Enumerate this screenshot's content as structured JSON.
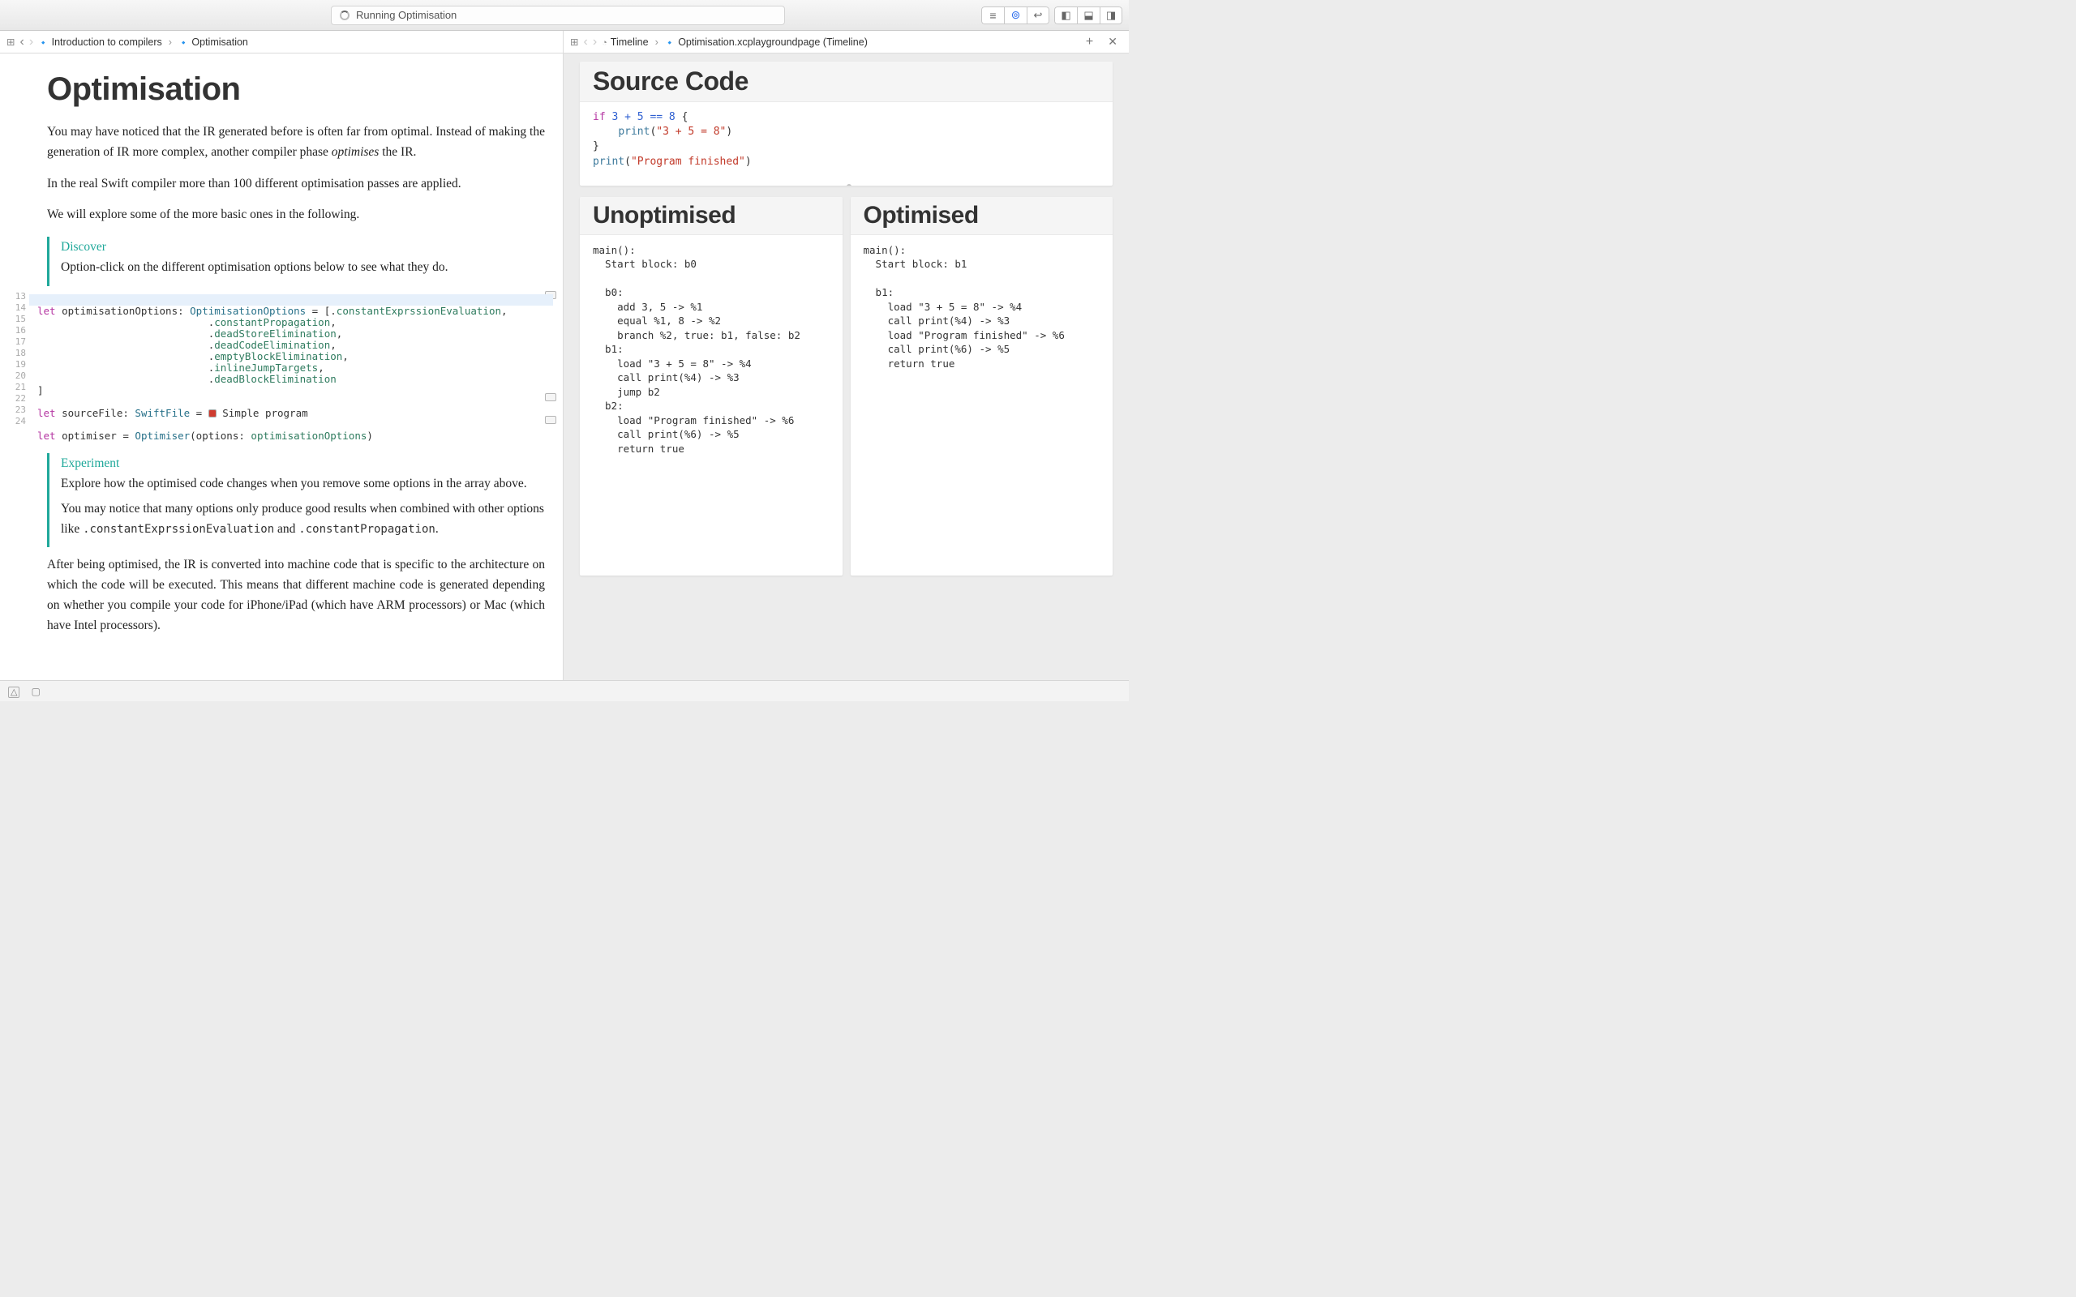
{
  "titlebar": {
    "status": "Running Optimisation"
  },
  "jumpbar_left": {
    "crumb1": "Introduction to compilers",
    "crumb2": "Optimisation"
  },
  "jumpbar_right": {
    "crumb1": "Timeline",
    "crumb2": "Optimisation.xcplaygroundpage (Timeline)"
  },
  "doc": {
    "h1": "Optimisation",
    "p1a": "You may have noticed that the IR generated before is often far from optimal. Instead of making the generation of IR more complex, another compiler phase ",
    "p1b": "optimises",
    "p1c": " the IR.",
    "p2": "In the real Swift compiler more than 100 different optimisation passes are applied.",
    "p3": "We will explore some of the more basic ones in the following.",
    "discover_title": "Discover",
    "discover_body": "Option-click on the different optimisation options below to see what they do.",
    "experiment_title": "Experiment",
    "experiment_p1": "Explore how the optimised code changes when you remove some options in the array above.",
    "experiment_p2a": "You may notice that many options only produce good results when combined with other options like ",
    "experiment_code1": ".constantExprssionEvaluation",
    "experiment_p2b": " and ",
    "experiment_code2": ".constantPropagation",
    "experiment_p2c": ".",
    "p4": "After being optimised, the IR is converted into machine code that is specific to the architecture on which the code will be executed. This means that different machine code is generated depending on whether you compile your code for iPhone/iPad (which have ARM processors) or Mac (which have Intel processors)."
  },
  "code": {
    "line13a": "let",
    "line13b": " optimisationOptions: ",
    "line13c": "OptimisationOptions",
    "line13d": " = [.",
    "line13e": "constantExprssionEvaluation",
    "line13f": ",",
    "line14a": "                            .",
    "line14b": "constantPropagation",
    "line14c": ",",
    "line15a": "                            .",
    "line15b": "deadStoreElimination",
    "line15c": ",",
    "line16a": "                            .",
    "line16b": "deadCodeElimination",
    "line16c": ",",
    "line17a": "                            .",
    "line17b": "emptyBlockElimination",
    "line17c": ",",
    "line18a": "                            .",
    "line18b": "inlineJumpTargets",
    "line18c": ",",
    "line19a": "                            .",
    "line19b": "deadBlockElimination",
    "line20": "]",
    "line22a": "let",
    "line22b": " sourceFile: ",
    "line22c": "SwiftFile",
    "line22d": " = ",
    "line22e": " Simple program",
    "line24a": "let",
    "line24b": " optimiser = ",
    "line24c": "Optimiser",
    "line24d": "(options: ",
    "line24e": "optimisationOptions",
    "line24f": ")"
  },
  "gutter_lines": [
    "13",
    "14",
    "15",
    "16",
    "17",
    "18",
    "19",
    "20",
    "21",
    "22",
    "23",
    "24"
  ],
  "source_panel": {
    "title": "Source Code",
    "l1_if": "if",
    "l1_expr": " 3 + 5 == 8 ",
    "l1_brace": "{",
    "l2_indent": "    ",
    "l2_call": "print",
    "l2_open": "(",
    "l2_str": "\"3 + 5 = 8\"",
    "l2_close": ")",
    "l3": "}",
    "l4_call": "print",
    "l4_open": "(",
    "l4_str": "\"Program finished\"",
    "l4_close": ")"
  },
  "unopt": {
    "title": "Unoptimised",
    "body": "main():\n  Start block: b0\n\n  b0:\n    add 3, 5 -> %1\n    equal %1, 8 -> %2\n    branch %2, true: b1, false: b2\n  b1:\n    load \"3 + 5 = 8\" -> %4\n    call print(%4) -> %3\n    jump b2\n  b2:\n    load \"Program finished\" -> %6\n    call print(%6) -> %5\n    return true"
  },
  "opt": {
    "title": "Optimised",
    "body": "main():\n  Start block: b1\n\n  b1:\n    load \"3 + 5 = 8\" -> %4\n    call print(%4) -> %3\n    load \"Program finished\" -> %6\n    call print(%6) -> %5\n    return true"
  }
}
